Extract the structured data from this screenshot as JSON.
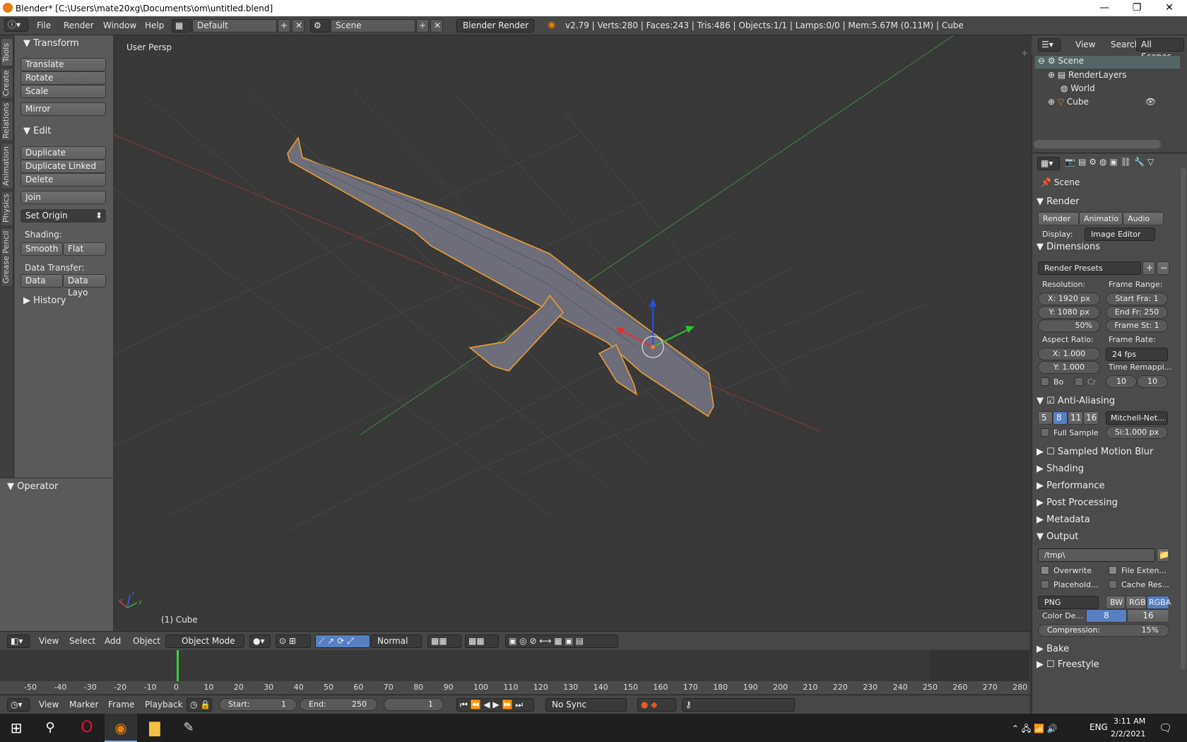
{
  "window": {
    "title": "Blender* [C:\\Users\\mate20xg\\Documents\\om\\untitled.blend]",
    "minimize": "—",
    "maximize": "❐",
    "close": "✕"
  },
  "info_header": {
    "menus": [
      "File",
      "Render",
      "Window",
      "Help"
    ],
    "layout": "Default",
    "scene": "Scene",
    "engine": "Blender Render",
    "stats": "v2.79 | Verts:280 | Faces:243 | Tris:486 | Objects:1/1 | Lamps:0/0 | Mem:5.67M (0.11M) | Cube"
  },
  "tool_shelf": {
    "tabs": [
      "Tools",
      "Create",
      "Relations",
      "Animation",
      "Physics",
      "Grease Pencil"
    ],
    "transform_title": "Transform",
    "translate": "Translate",
    "rotate": "Rotate",
    "scale": "Scale",
    "mirror": "Mirror",
    "edit_title": "Edit",
    "duplicate": "Duplicate",
    "duplicate_linked": "Duplicate Linked",
    "delete": "Delete",
    "join": "Join",
    "set_origin": "Set Origin",
    "shading_label": "Shading:",
    "smooth": "Smooth",
    "flat": "Flat",
    "data_transfer_label": "Data Transfer:",
    "data": "Data",
    "data_layo": "Data Layo",
    "history_title": "History",
    "operator_title": "Operator"
  },
  "viewport": {
    "view_name": "User Persp",
    "object_label": "(1) Cube",
    "axis_x": "x",
    "axis_y": "y",
    "axis_z": "z"
  },
  "view3d_header": {
    "menus": [
      "View",
      "Select",
      "Add",
      "Object"
    ],
    "mode": "Object Mode",
    "orientation": "Normal"
  },
  "timeline": {
    "ticks": [
      "-50",
      "-40",
      "-30",
      "-20",
      "-10",
      "0",
      "10",
      "20",
      "30",
      "40",
      "50",
      "60",
      "70",
      "80",
      "90",
      "100",
      "110",
      "120",
      "130",
      "140",
      "150",
      "160",
      "170",
      "180",
      "190",
      "200",
      "210",
      "220",
      "230",
      "240",
      "250",
      "260",
      "270",
      "280"
    ],
    "menus": [
      "View",
      "Marker",
      "Frame",
      "Playback"
    ],
    "start_label": "Start:",
    "start_value": "1",
    "end_label": "End:",
    "end_value": "250",
    "current_frame": "1",
    "sync": "No Sync"
  },
  "outliner": {
    "menus": [
      "View",
      "Search"
    ],
    "filter": "All Scenes",
    "items": [
      "Scene",
      "RenderLayers",
      "World",
      "Cube"
    ]
  },
  "properties": {
    "context": "Scene",
    "render": {
      "title": "Render",
      "buttons": [
        "Render",
        "Animatio",
        "Audio"
      ],
      "display_label": "Display:",
      "display_value": "Image Editor"
    },
    "dimensions": {
      "title": "Dimensions",
      "presets": "Render Presets",
      "resolution_label": "Resolution:",
      "res_x": "X: 1920 px",
      "res_y": "Y: 1080 px",
      "res_pct": "50%",
      "frame_range_label": "Frame Range:",
      "start_frame": "Start Fra:  1",
      "end_frame": "End Fr: 250",
      "frame_step": "Frame St:  1",
      "aspect_label": "Aspect Ratio:",
      "aspect_x": "X:     1.000",
      "aspect_y": "Y:     1.000",
      "frame_rate_label": "Frame Rate:",
      "frame_rate": "24 fps",
      "time_remap_label": "Time Remappi...",
      "remap_old": "10",
      "remap_new": "10",
      "border": "Bo",
      "crop": "Cr"
    },
    "anti_aliasing": {
      "title": "Anti-Aliasing",
      "samples": [
        "5",
        "8",
        "11",
        "16"
      ],
      "filter": "Mitchell-Net...",
      "full_sample": "Full Sample",
      "size": "Si:1.000 px"
    },
    "collapsed": [
      "Sampled Motion Blur",
      "Shading",
      "Performance",
      "Post Processing",
      "Metadata"
    ],
    "output": {
      "title": "Output",
      "path": "/tmp\\",
      "overwrite": "Overwrite",
      "file_ext": "File Exten...",
      "placeholders": "Placehold...",
      "cache": "Cache Res...",
      "format": "PNG",
      "bw": "BW",
      "rgb": "RGB",
      "rgba": "RGBA",
      "color_depth_label": "Color De...",
      "depth_8": "8",
      "depth_16": "16",
      "compression": "Compression:",
      "compression_value": "15%"
    },
    "bake": "Bake",
    "freestyle": "Freestyle"
  },
  "taskbar": {
    "time": "3:11 AM",
    "date": "2/2/2021",
    "lang": "ENG"
  },
  "colors": {
    "selected_outline": "#f0a030",
    "object": "#6e6e7a",
    "accent_blue": "#5680c2",
    "grid": "#454545"
  }
}
